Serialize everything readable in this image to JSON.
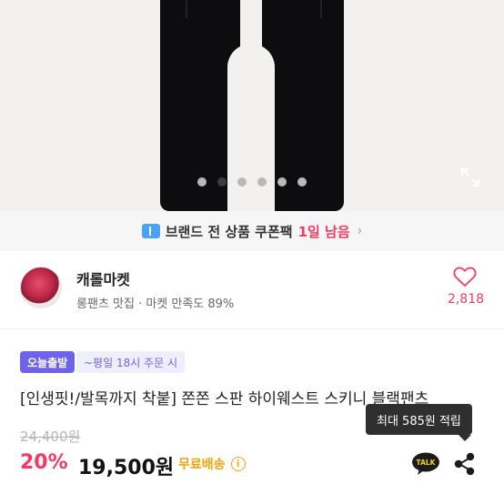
{
  "gallery": {
    "slide_count": 6,
    "active_index": 1
  },
  "coupon_banner": {
    "text_main": "브랜드 전 상품 쿠폰팩",
    "text_highlight": "1일 남음",
    "chevron": "›"
  },
  "seller": {
    "name": "캐롤마켓",
    "subtitle": "롱팬츠 맛집 · 마켓 만족도 89%",
    "likes": "2,818"
  },
  "delivery": {
    "today_label": "오늘출발",
    "time_label": "~평일 18시 주문 시"
  },
  "product": {
    "title": "[인생핏!/발목까지 착붙] 쫀쫀 스판 하이웨스트 스키니 블랙팬츠",
    "original_price": "24,400원",
    "discount": "20%",
    "price": "19,500원",
    "shipping": "무료배송",
    "info_icon": "i"
  },
  "tooltip": {
    "text": "최대 585원 적립"
  },
  "icons": {
    "kakao_label": "TALK"
  },
  "colors": {
    "accent": "#f43a64",
    "today_tag": "#6f64e8",
    "free_shipping": "#f5a30a"
  }
}
